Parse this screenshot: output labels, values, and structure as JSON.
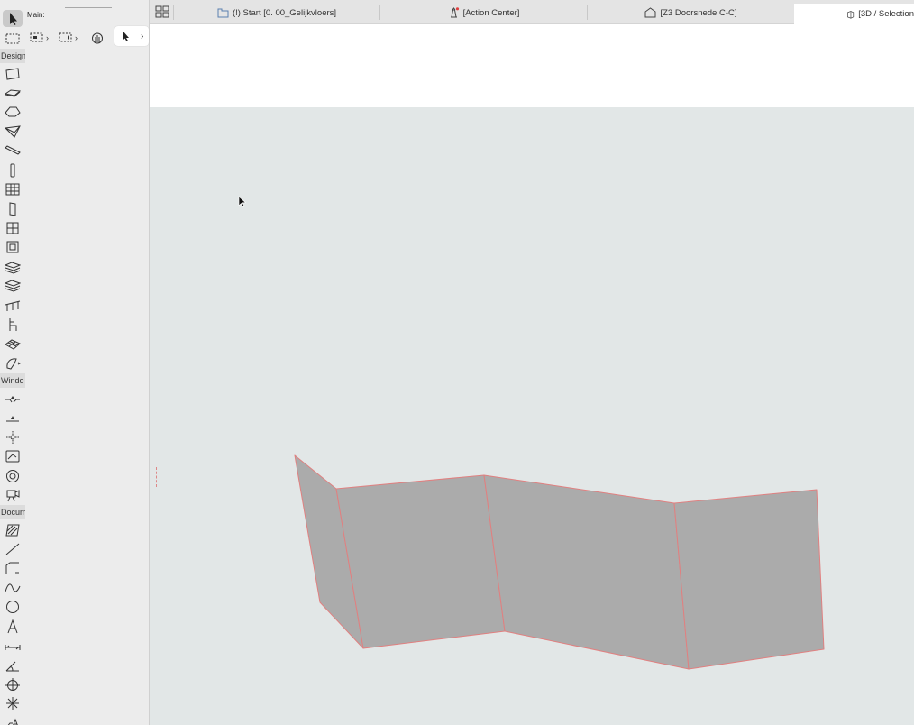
{
  "toolbox": {
    "sections": [
      {
        "label": "Design"
      },
      {
        "label": "Windo"
      },
      {
        "label": "Docum"
      }
    ],
    "tools": [
      {
        "name": "arrow-tool",
        "icon": "arrow-icon"
      },
      {
        "name": "marquee-tool",
        "icon": "marquee-icon"
      },
      {
        "name": "wall-tool",
        "icon": "wall-icon"
      },
      {
        "name": "slab-tool",
        "icon": "slab-icon"
      },
      {
        "name": "roof-tool",
        "icon": "roof-icon"
      },
      {
        "name": "shell-tool",
        "icon": "shell-icon"
      },
      {
        "name": "beam-tool",
        "icon": "beam-icon"
      },
      {
        "name": "column-tool",
        "icon": "column-icon"
      },
      {
        "name": "curtain-wall-tool",
        "icon": "curtain-wall-icon"
      },
      {
        "name": "door-tool",
        "icon": "door-icon"
      },
      {
        "name": "window-tool",
        "icon": "window-icon"
      },
      {
        "name": "skylight-tool",
        "icon": "skylight-icon"
      },
      {
        "name": "stair-tool",
        "icon": "stair-icon"
      },
      {
        "name": "stair-2-tool",
        "icon": "stair-alt-icon"
      },
      {
        "name": "railing-tool",
        "icon": "railing-icon"
      },
      {
        "name": "object-tool",
        "icon": "chair-icon"
      },
      {
        "name": "mesh-tool",
        "icon": "mesh-icon"
      },
      {
        "name": "morph-tool",
        "icon": "morph-icon"
      },
      {
        "name": "level-dimension-tool",
        "icon": "level-dimension-icon"
      },
      {
        "name": "elevation-dimension-tool",
        "icon": "elevation-icon"
      },
      {
        "name": "grid-element-tool",
        "icon": "grid-element-icon"
      },
      {
        "name": "worksheet-tool",
        "icon": "worksheet-icon"
      },
      {
        "name": "detail-tool",
        "icon": "detail-icon"
      },
      {
        "name": "camera-tool",
        "icon": "camera-icon"
      },
      {
        "name": "fill-tool",
        "icon": "fill-icon"
      },
      {
        "name": "line-tool",
        "icon": "line-icon"
      },
      {
        "name": "polyline-tool",
        "icon": "polyline-icon"
      },
      {
        "name": "spline-tool",
        "icon": "spline-icon"
      },
      {
        "name": "circle-tool",
        "icon": "circle-icon"
      },
      {
        "name": "text-tool",
        "icon": "text-icon"
      },
      {
        "name": "dimension-tool",
        "icon": "dimension-icon"
      },
      {
        "name": "angle-dimension-tool",
        "icon": "angle-dimension-icon"
      },
      {
        "name": "radial-dimension-tool",
        "icon": "radial-dimension-icon"
      },
      {
        "name": "hotspot-tool",
        "icon": "hotspot-icon"
      },
      {
        "name": "label-tool",
        "icon": "label-icon"
      }
    ]
  },
  "infobox": {
    "main_label": "Main:"
  },
  "tabs": [
    {
      "label": "(!) Start [0. 00_Gelijkvloers]",
      "icon": "floor-plan-icon"
    },
    {
      "label": "[Action Center]",
      "icon": "lighthouse-icon"
    },
    {
      "label": "[Z3 Doorsnede C-C]",
      "icon": "section-icon"
    },
    {
      "label": "[3D / Selection",
      "icon": "3d-window-icon",
      "active": true
    }
  ],
  "colors": {
    "viewport_bg": "#e2e7e7",
    "wall_fill": "#ababab",
    "wall_edge": "#e08080"
  }
}
